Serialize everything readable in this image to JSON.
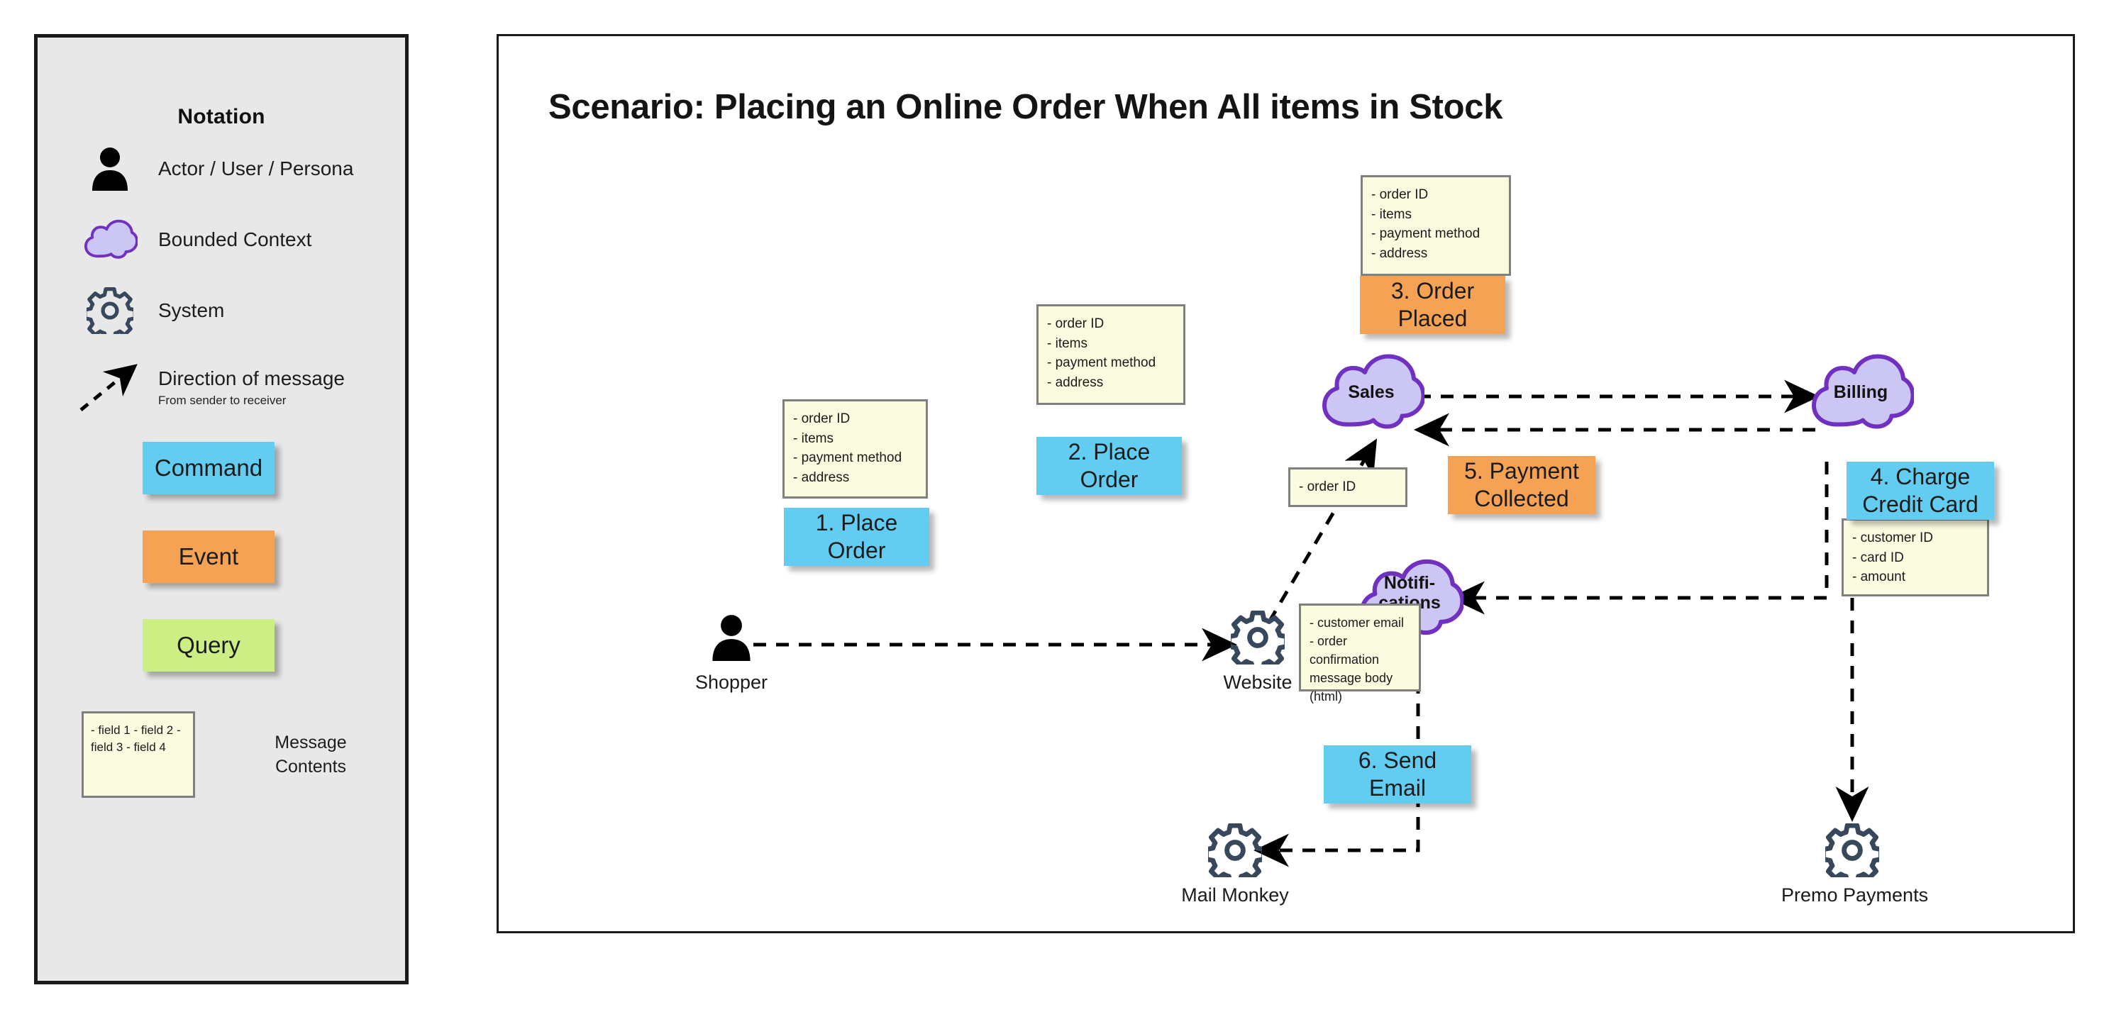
{
  "legend": {
    "title": "Notation",
    "items": [
      {
        "icon": "actor-icon",
        "label": "Actor / User / Persona",
        "sublabel": ""
      },
      {
        "icon": "cloud-icon",
        "label": "Bounded Context",
        "sublabel": ""
      },
      {
        "icon": "gear-icon",
        "label": "System",
        "sublabel": ""
      },
      {
        "icon": "dashed-arrow-icon",
        "label": "Direction of message",
        "sublabel": "From sender to receiver"
      }
    ],
    "swatches": [
      {
        "label": "Command",
        "color": "#62cdf0"
      },
      {
        "label": "Event",
        "color": "#f5a254"
      },
      {
        "label": "Query",
        "color": "#cdee85"
      }
    ],
    "note_example": "- field 1\n- field 2\n- field 3\n- field 4",
    "note_caption": "Message\nContents"
  },
  "canvas": {
    "title": "Scenario: Placing an Online Order When All items in Stock",
    "nodes": [
      {
        "id": "shopper",
        "type": "actor",
        "label": "Shopper"
      },
      {
        "id": "website",
        "type": "system",
        "label": "Website"
      },
      {
        "id": "sales",
        "type": "context",
        "label": "Sales"
      },
      {
        "id": "billing",
        "type": "context",
        "label": "Billing"
      },
      {
        "id": "notifications",
        "type": "context",
        "label": "Notifi-\ncations"
      },
      {
        "id": "mail-monkey",
        "type": "system",
        "label": "Mail Monkey"
      },
      {
        "id": "premo-payments",
        "type": "system",
        "label": "Premo Payments"
      }
    ],
    "stickies": [
      {
        "id": "step-1",
        "kind": "command",
        "label": "1. Place\nOrder"
      },
      {
        "id": "step-2",
        "kind": "command",
        "label": "2. Place\nOrder"
      },
      {
        "id": "step-3",
        "kind": "event",
        "label": "3. Order\nPlaced"
      },
      {
        "id": "step-4",
        "kind": "command",
        "label": "4. Charge\nCredit Card"
      },
      {
        "id": "step-5",
        "kind": "event",
        "label": "5. Payment\nCollected"
      },
      {
        "id": "step-6",
        "kind": "command",
        "label": "6. Send\nEmail"
      }
    ],
    "notes": [
      {
        "id": "note-1",
        "text": "- order ID\n- items\n- payment method\n- address"
      },
      {
        "id": "note-2",
        "text": "- order ID\n- items\n- payment method\n- address"
      },
      {
        "id": "note-3",
        "text": "- order ID\n- items\n- payment method\n- address"
      },
      {
        "id": "note-5",
        "text": "- order ID"
      },
      {
        "id": "note-4",
        "text": "- customer ID\n- card ID\n- amount"
      },
      {
        "id": "note-6",
        "text": "- customer email\n- order confirmation\nmessage body\n(html)"
      }
    ]
  },
  "colors": {
    "command": "#62cdf0",
    "event": "#f5a254",
    "query": "#cdee85",
    "note": "#fbfbe0",
    "note_border": "#808080",
    "cloud_fill": "#ccc6f5",
    "cloud_stroke": "#7030c0",
    "gear": "#37485c",
    "panel_bg": "#e8e8e8",
    "frame": "#1a1a1a"
  }
}
